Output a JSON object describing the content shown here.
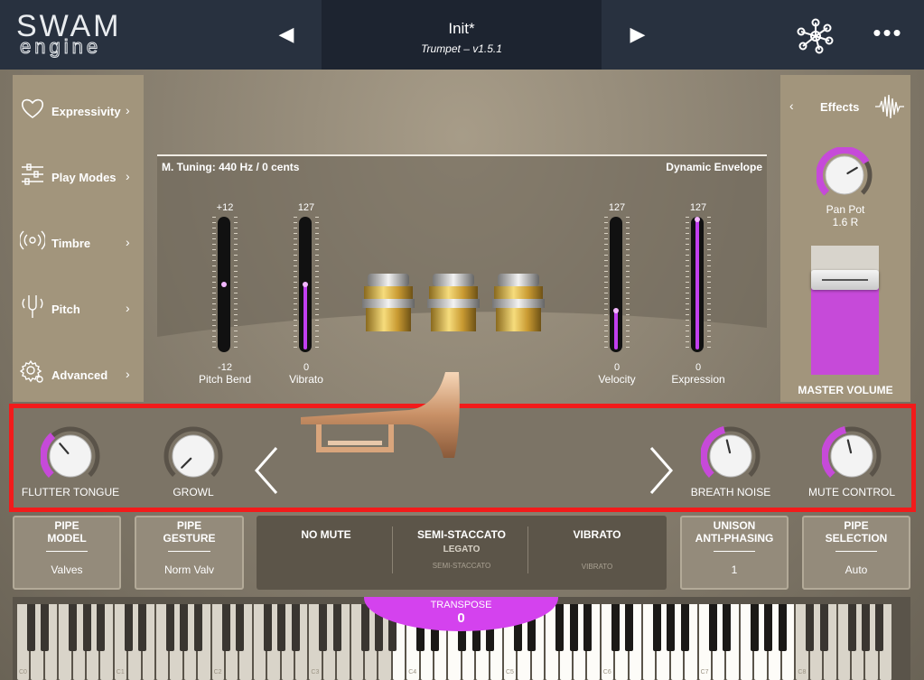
{
  "header": {
    "logo_top": "SWAM",
    "logo_bottom": "engine",
    "prev_glyph": "◀",
    "next_glyph": "▶",
    "preset_name": "Init*",
    "preset_subtitle": "Trumpet – v1.5.1",
    "more_glyph": "•••"
  },
  "sidebar": {
    "items": [
      {
        "label": "Expressivity",
        "icon": "heart-icon"
      },
      {
        "label": "Play Modes",
        "icon": "sliders-icon"
      },
      {
        "label": "Timbre",
        "icon": "radio-waves-icon"
      },
      {
        "label": "Pitch",
        "icon": "tuning-fork-icon"
      },
      {
        "label": "Advanced",
        "icon": "gear-icon"
      }
    ],
    "chevron": "›"
  },
  "effects": {
    "back": "‹",
    "label": "Effects",
    "pan_label": "Pan Pot",
    "pan_value": "1.6 R",
    "master_label": "MASTER VOLUME",
    "master_level": 0.78
  },
  "instrument": {
    "tuning": "M. Tuning: 440 Hz / 0 cents",
    "envelope": "Dynamic Envelope",
    "sliders": [
      {
        "name": "Pitch Bend",
        "max": "+12",
        "min": "-12",
        "value": 0.5,
        "fill": false
      },
      {
        "name": "Vibrato",
        "max": "127",
        "min": "0",
        "value": 0.5,
        "fill": true
      },
      {
        "name": "Velocity",
        "max": "127",
        "min": "0",
        "value": 0.3,
        "fill": true
      },
      {
        "name": "Expression",
        "max": "127",
        "min": "0",
        "value": 1.0,
        "fill": true
      }
    ]
  },
  "knobs": [
    {
      "label": "FLUTTER TONGUE",
      "value": 0.35
    },
    {
      "label": "GROWL",
      "value": 0.0
    },
    {
      "label": "BREATH NOISE",
      "value": 0.45
    },
    {
      "label": "MUTE CONTROL",
      "value": 0.45
    }
  ],
  "modes": {
    "pipe_model": {
      "title1": "PIPE",
      "title2": "MODEL",
      "value": "Valves"
    },
    "pipe_gesture": {
      "title1": "PIPE",
      "title2": "GESTURE",
      "value": "Norm Valv"
    },
    "mute": {
      "main": "NO MUTE",
      "sub": "",
      "small": ""
    },
    "articulation": {
      "main": "SEMI-STACCATO",
      "sub": "LEGATO",
      "small": "SEMI-STACCATO"
    },
    "vibrato": {
      "main": "VIBRATO",
      "sub": "",
      "small": "VIBRATO"
    },
    "unison": {
      "title1": "UNISON",
      "title2": "ANTI-PHASING",
      "value": "1"
    },
    "pipe_selection": {
      "title1": "PIPE",
      "title2": "SELECTION",
      "value": "Auto"
    }
  },
  "transpose": {
    "label": "TRANSPOSE",
    "value": "0"
  },
  "keyboard": {
    "octaves": [
      "C0",
      "C1",
      "C2",
      "C3",
      "C4",
      "C5",
      "C6",
      "C7",
      "C8"
    ],
    "active_white_range": [
      27,
      55
    ]
  },
  "colors": {
    "accent": "#c64ad9",
    "header_bg": "#28313f",
    "highlight_border": "#f21b1b"
  }
}
